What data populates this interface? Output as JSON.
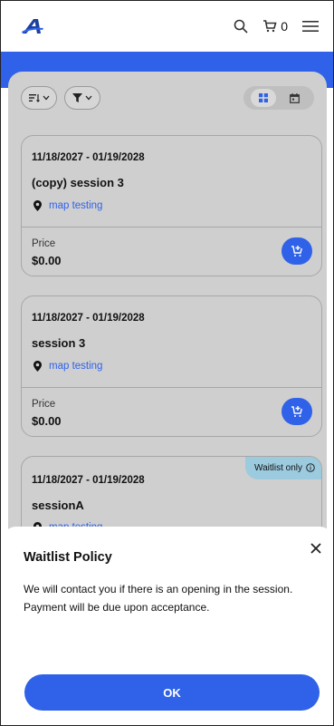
{
  "header": {
    "logo": "brand-logo",
    "search_icon": "search-icon",
    "cart_count": "0",
    "menu_icon": "hamburger-menu-icon"
  },
  "toolbar": {
    "sort_icon": "sort-icon",
    "filter_icon": "filter-icon",
    "view_grid_icon": "grid-view-icon",
    "view_calendar_icon": "calendar-view-icon"
  },
  "sessions": [
    {
      "dates": "11/18/2027 - 01/19/2028",
      "name": "(copy) session 3",
      "location": "map testing",
      "price_label": "Price",
      "price": "$0.00"
    },
    {
      "dates": "11/18/2027 - 01/19/2028",
      "name": "session 3",
      "location": "map testing",
      "price_label": "Price",
      "price": "$0.00"
    },
    {
      "dates": "11/18/2027 - 01/19/2028",
      "name": "sessionA",
      "location": "map testing",
      "badge": "Waitlist only"
    }
  ],
  "modal": {
    "title": "Waitlist Policy",
    "body": "We will contact you if there is an opening in the session. Payment will be due upon acceptance.",
    "ok_label": "OK"
  },
  "colors": {
    "primary": "#2f62e8",
    "waitlist_badge": "#9ccbdf"
  }
}
